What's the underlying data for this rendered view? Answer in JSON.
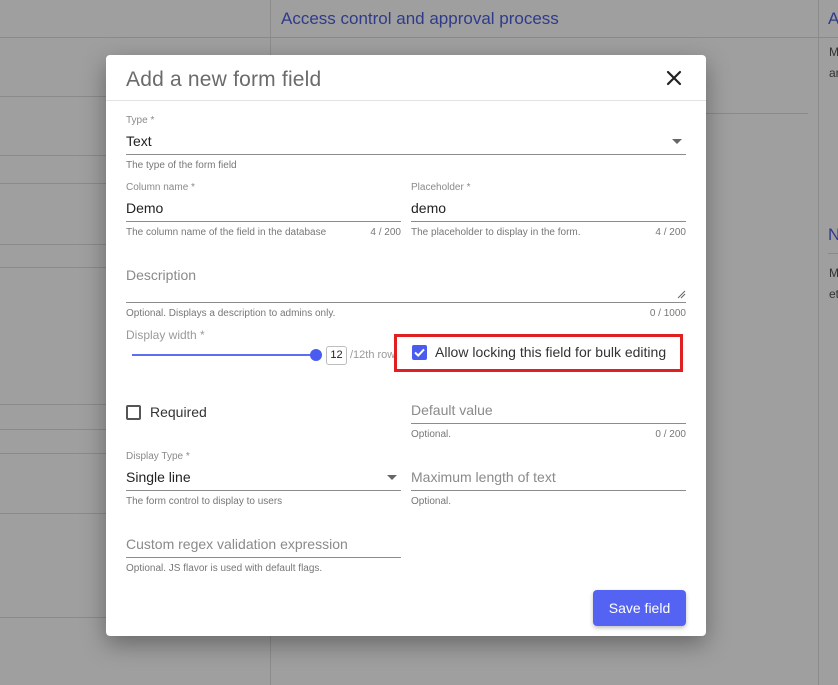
{
  "background": {
    "heading": "Access control and approval process",
    "right_heading_1": "A",
    "right_heading_2": "N",
    "right_text_1a": "M",
    "right_text_1b": "ar",
    "right_text_2a": "M",
    "right_text_2b": "et"
  },
  "modal": {
    "title": "Add a new form field",
    "close_icon": "close-icon",
    "type": {
      "label": "Type *",
      "value": "Text",
      "hint": "The type of the form field"
    },
    "column_name": {
      "label": "Column name *",
      "value": "Demo",
      "hint": "The column name of the field in the database",
      "counter": "4 / 200"
    },
    "placeholder": {
      "label": "Placeholder *",
      "value": "demo",
      "hint": "The placeholder to display in the form.",
      "counter": "4 / 200"
    },
    "description": {
      "placeholder": "Description",
      "hint": "Optional. Displays a description to admins only.",
      "counter": "0 / 1000"
    },
    "display_width": {
      "label": "Display width *",
      "value": "12",
      "suffix": "/12th row",
      "level": 1.0
    },
    "allow_locking": {
      "label": "Allow locking this field for bulk editing",
      "checked": true
    },
    "required": {
      "label": "Required",
      "checked": false
    },
    "default_value": {
      "placeholder": "Default value",
      "hint": "Optional.",
      "counter": "0 / 200"
    },
    "display_type": {
      "label": "Display Type *",
      "value": "Single line",
      "hint": "The form control to display to users"
    },
    "max_length": {
      "placeholder": "Maximum length of text",
      "hint": "Optional."
    },
    "regex": {
      "placeholder": "Custom regex validation expression",
      "hint": "Optional. JS flavor is used with default flags."
    },
    "save_label": "Save field"
  },
  "colors": {
    "accent": "#5463f2",
    "highlight": "#e02020"
  }
}
